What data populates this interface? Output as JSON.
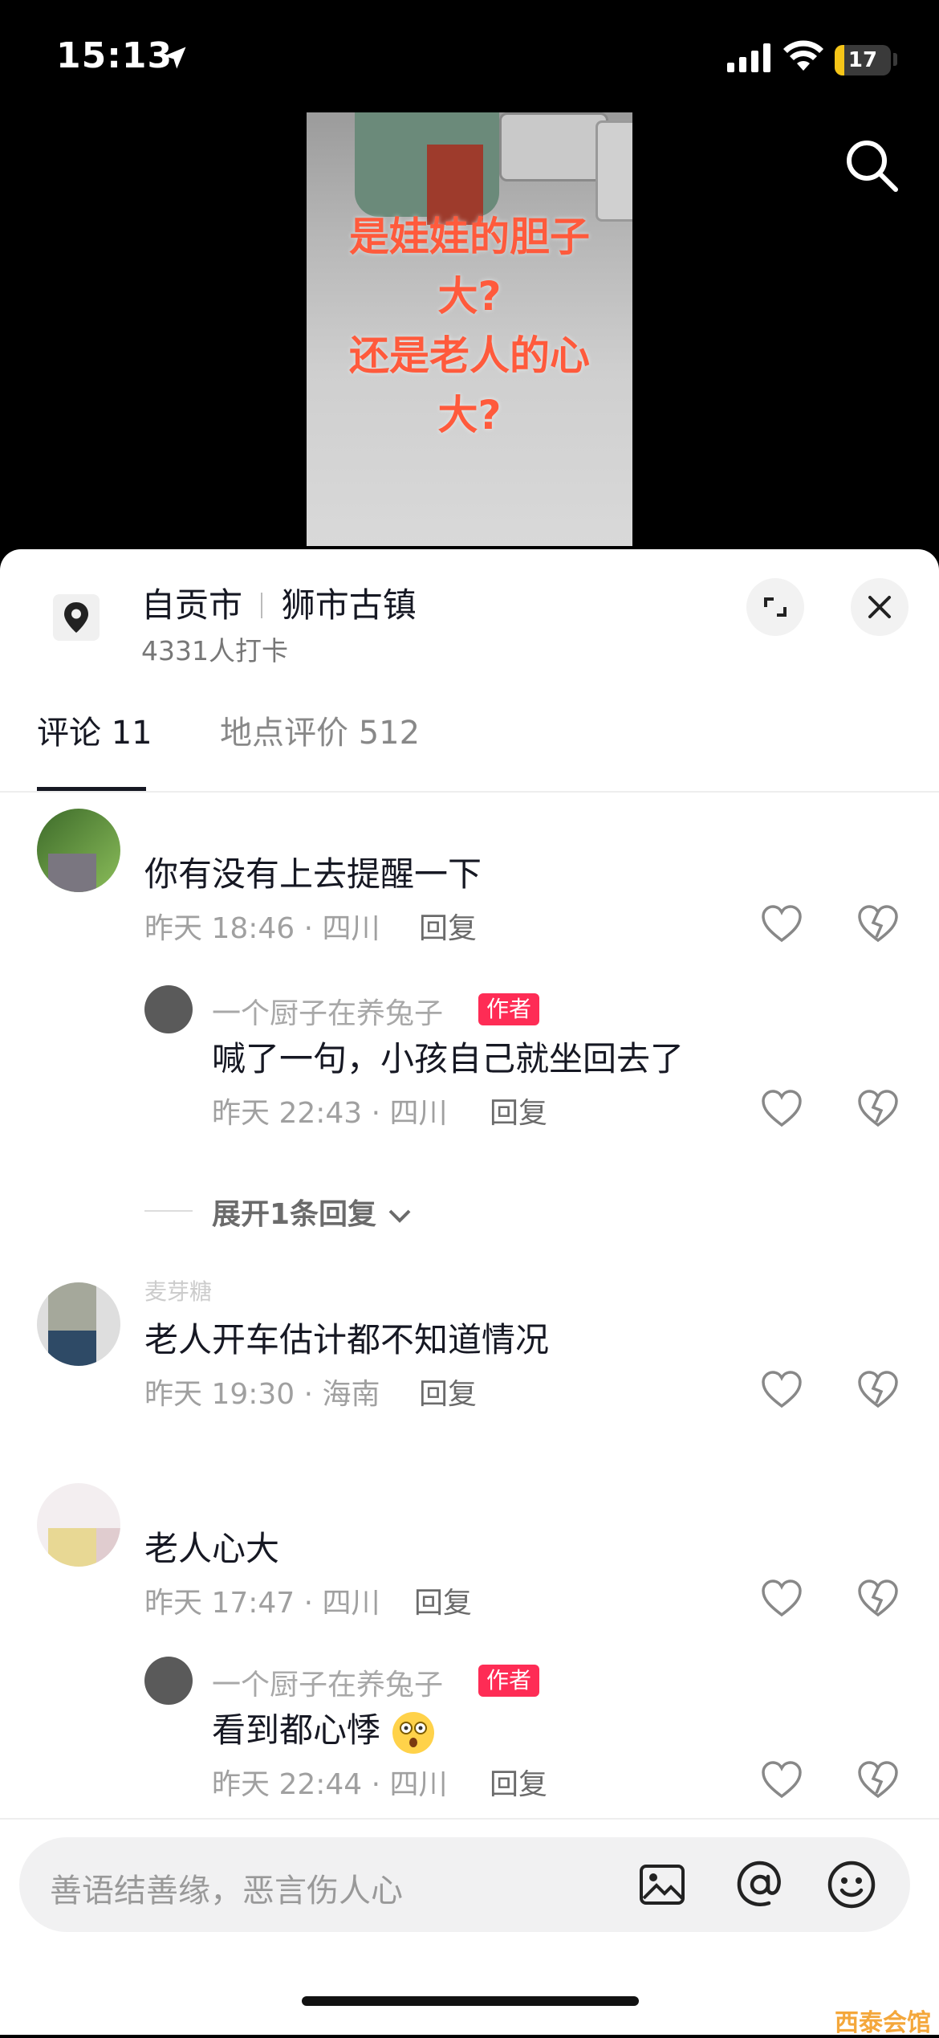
{
  "status_bar": {
    "time": "15:13",
    "battery": "17",
    "battery_level": 0.17
  },
  "video": {
    "caption_lines": [
      "是娃娃的胆子",
      "大?",
      "还是老人的心",
      "大?"
    ]
  },
  "place": {
    "name": "自贡市",
    "subname": "狮市古镇",
    "checkins": "4331人打卡"
  },
  "tabs": {
    "comments": "评论 11",
    "reviews": "地点评价 512"
  },
  "comments": [
    {
      "text": "你有没有上去提醒一下",
      "meta": "昨天 18:46 · 四川",
      "reply_label": "回复",
      "reply": {
        "author": "一个厨子在养兔子",
        "badge": "作者",
        "text": "喊了一句，小孩自己就坐回去了",
        "meta": "昨天 22:43 · 四川",
        "reply_label": "回复"
      },
      "expand": "展开1条回复"
    },
    {
      "username": "麦芽糖",
      "text": "老人开车估计都不知道情况",
      "meta": "昨天 19:30 · 海南",
      "reply_label": "回复"
    },
    {
      "text": "老人心大",
      "meta": "昨天 17:47 · 四川",
      "reply_label": "回复",
      "reply": {
        "author": "一个厨子在养兔子",
        "badge": "作者",
        "text": "看到都心悸",
        "meta": "昨天 22:44 · 四川",
        "reply_label": "回复"
      }
    }
  ],
  "input": {
    "placeholder": "善语结善缘，恶言伤人心"
  },
  "watermark": "西泰会馆",
  "colors": {
    "accent": "#fe2c55",
    "caption": "#ff5a3c"
  }
}
